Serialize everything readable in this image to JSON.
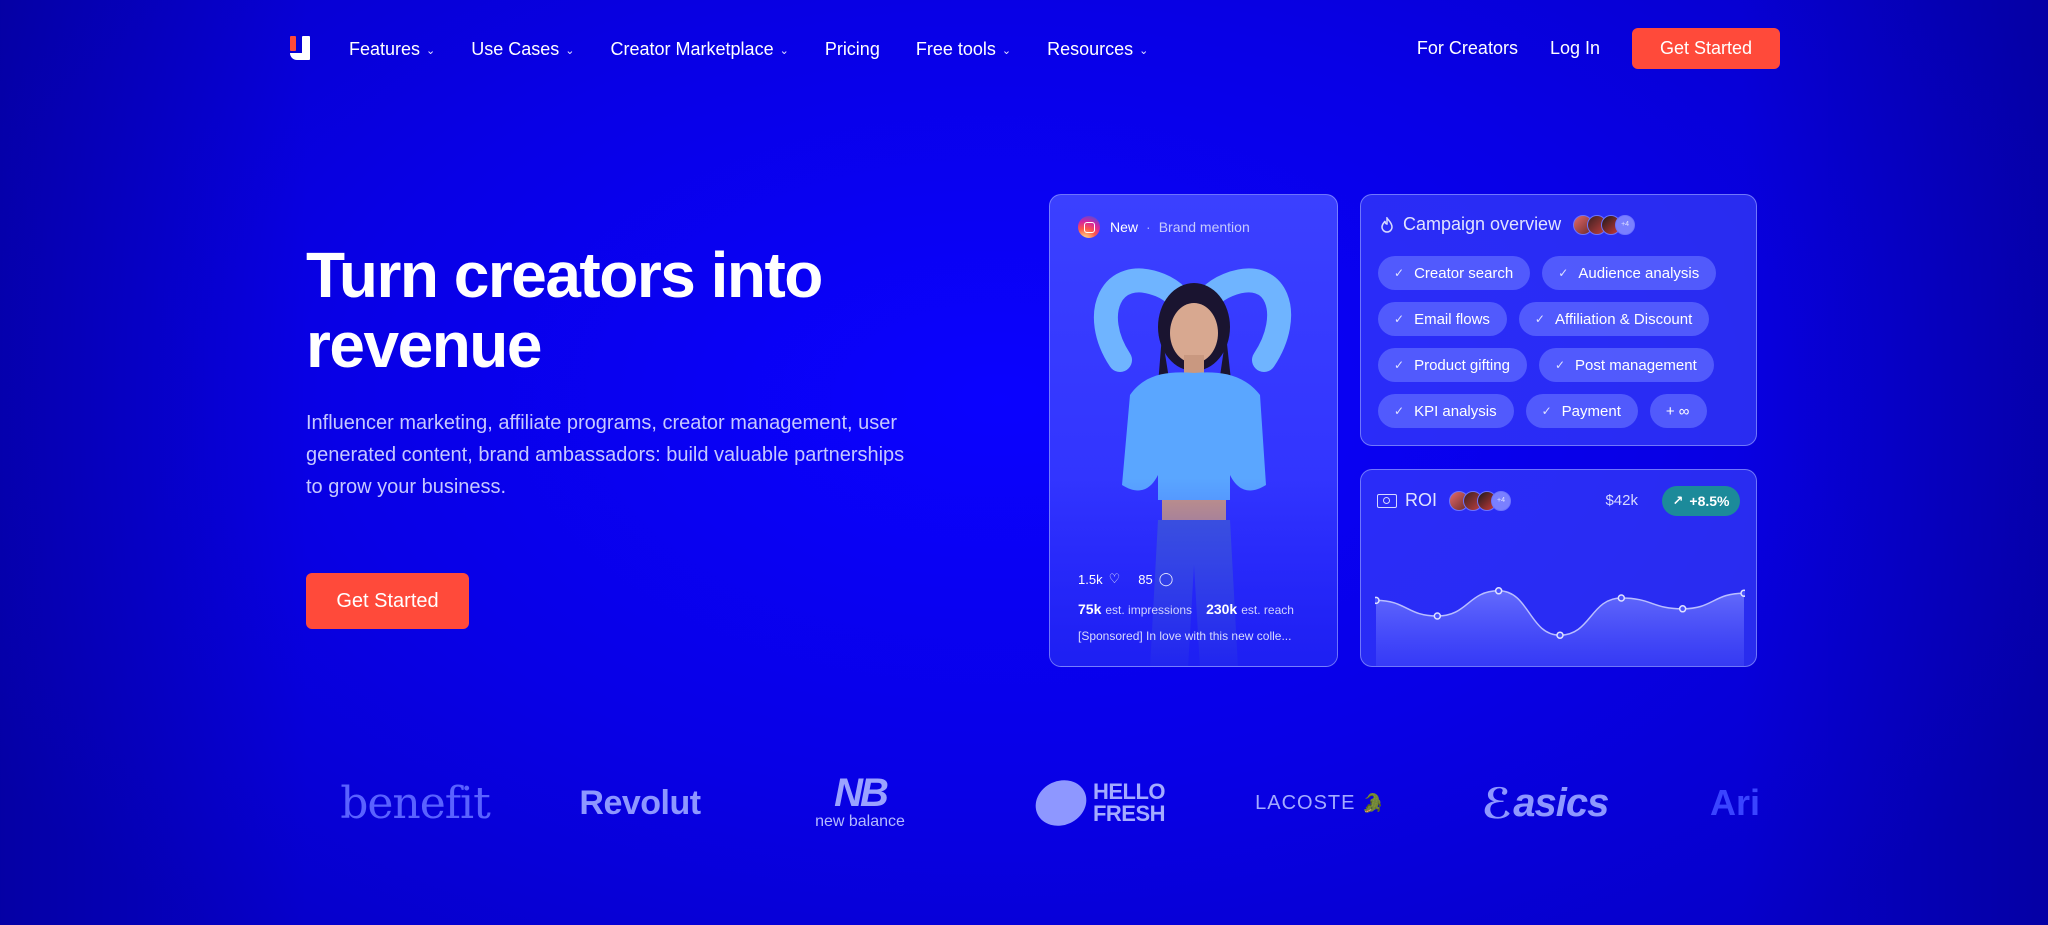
{
  "nav": {
    "menu": [
      {
        "label": "Features",
        "has_dropdown": true
      },
      {
        "label": "Use Cases",
        "has_dropdown": true
      },
      {
        "label": "Creator Marketplace",
        "has_dropdown": true
      },
      {
        "label": "Pricing",
        "has_dropdown": false
      },
      {
        "label": "Free tools",
        "has_dropdown": true
      },
      {
        "label": "Resources",
        "has_dropdown": true
      }
    ],
    "chevron": "⌄",
    "for_creators": "For Creators",
    "login": "Log In",
    "get_started": "Get Started"
  },
  "hero": {
    "title": "Turn creators into revenue",
    "subtitle": "Influencer marketing, affiliate programs, creator management, user generated content, brand ambassadors: build valuable partnerships to grow your business.",
    "cta": "Get Started"
  },
  "post_card": {
    "tag_new": "New",
    "separator": "·",
    "tag_type": "Brand mention",
    "likes": "1.5k",
    "comments": "85",
    "impressions_value": "75k",
    "impressions_label": "est. impressions",
    "reach_value": "230k",
    "reach_label": "est. reach",
    "caption": "[Sponsored] In love with this new colle..."
  },
  "overview_card": {
    "title": "Campaign overview",
    "avatars_more": "+4",
    "chips": [
      "Creator search",
      "Audience analysis",
      "Email flows",
      "Affiliation & Discount",
      "Product gifting",
      "Post management",
      "KPI analysis",
      "Payment"
    ],
    "more_chip": "+ ∞",
    "check": "✓"
  },
  "roi_card": {
    "title": "ROI",
    "avatars_more": "+4",
    "value": "$42k",
    "change": "+8.5%",
    "series": [
      0.48,
      0.35,
      0.56,
      0.19,
      0.5,
      0.41,
      0.54
    ]
  },
  "logos": {
    "benefit": "benefit",
    "revolut": "Revolut",
    "new_balance_mark": "NB",
    "new_balance_text": "new balance",
    "hellofresh_line1": "HELLO",
    "hellofresh_line2": "FRESH",
    "lacoste": "LACOSTE",
    "asics": "asics",
    "partial": "Ari"
  },
  "colors": {
    "background": "#0a00e8",
    "accent_red": "#ff4a3a",
    "roi_badge": "#1c8a9a"
  }
}
